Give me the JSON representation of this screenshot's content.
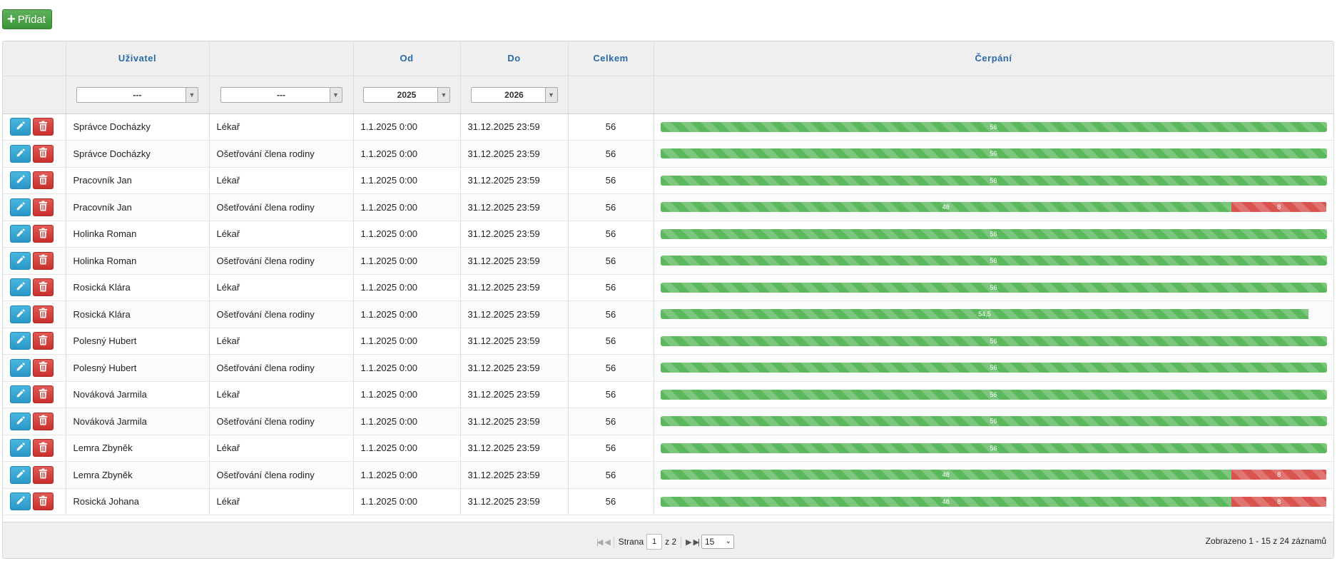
{
  "toolbar": {
    "add_label": "Přidat"
  },
  "columns": {
    "user": "Uživatel",
    "type": "",
    "from": "Od",
    "to": "Do",
    "total": "Celkem",
    "usage": "Čerpání"
  },
  "filters": {
    "user": "---",
    "type": "---",
    "from": "2025",
    "to": "2026"
  },
  "rows": [
    {
      "user": "Správce Docházky",
      "type": "Lékař",
      "from": "1.1.2025 0:00",
      "to": "31.12.2025 23:59",
      "total": "56",
      "used": "56",
      "over": ""
    },
    {
      "user": "Správce Docházky",
      "type": "Ošetřování člena rodiny",
      "from": "1.1.2025 0:00",
      "to": "31.12.2025 23:59",
      "total": "56",
      "used": "56",
      "over": ""
    },
    {
      "user": "Pracovník Jan",
      "type": "Lékař",
      "from": "1.1.2025 0:00",
      "to": "31.12.2025 23:59",
      "total": "56",
      "used": "56",
      "over": ""
    },
    {
      "user": "Pracovník Jan",
      "type": "Ošetřování člena rodiny",
      "from": "1.1.2025 0:00",
      "to": "31.12.2025 23:59",
      "total": "56",
      "used": "48",
      "over": "8"
    },
    {
      "user": "Holinka Roman",
      "type": "Lékař",
      "from": "1.1.2025 0:00",
      "to": "31.12.2025 23:59",
      "total": "56",
      "used": "56",
      "over": ""
    },
    {
      "user": "Holinka Roman",
      "type": "Ošetřování člena rodiny",
      "from": "1.1.2025 0:00",
      "to": "31.12.2025 23:59",
      "total": "56",
      "used": "56",
      "over": ""
    },
    {
      "user": "Rosická Klára",
      "type": "Lékař",
      "from": "1.1.2025 0:00",
      "to": "31.12.2025 23:59",
      "total": "56",
      "used": "56",
      "over": ""
    },
    {
      "user": "Rosická Klára",
      "type": "Ošetřování člena rodiny",
      "from": "1.1.2025 0:00",
      "to": "31.12.2025 23:59",
      "total": "56",
      "used": "54,5",
      "over": ""
    },
    {
      "user": "Polesný Hubert",
      "type": "Lékař",
      "from": "1.1.2025 0:00",
      "to": "31.12.2025 23:59",
      "total": "56",
      "used": "56",
      "over": ""
    },
    {
      "user": "Polesný Hubert",
      "type": "Ošetřování člena rodiny",
      "from": "1.1.2025 0:00",
      "to": "31.12.2025 23:59",
      "total": "56",
      "used": "56",
      "over": ""
    },
    {
      "user": "Nováková Jarmila",
      "type": "Lékař",
      "from": "1.1.2025 0:00",
      "to": "31.12.2025 23:59",
      "total": "56",
      "used": "56",
      "over": ""
    },
    {
      "user": "Nováková Jarmila",
      "type": "Ošetřování člena rodiny",
      "from": "1.1.2025 0:00",
      "to": "31.12.2025 23:59",
      "total": "56",
      "used": "56",
      "over": ""
    },
    {
      "user": "Lemra Zbyněk",
      "type": "Lékař",
      "from": "1.1.2025 0:00",
      "to": "31.12.2025 23:59",
      "total": "56",
      "used": "56",
      "over": ""
    },
    {
      "user": "Lemra Zbyněk",
      "type": "Ošetřování člena rodiny",
      "from": "1.1.2025 0:00",
      "to": "31.12.2025 23:59",
      "total": "56",
      "used": "48",
      "over": "8"
    },
    {
      "user": "Rosická Johana",
      "type": "Lékař",
      "from": "1.1.2025 0:00",
      "to": "31.12.2025 23:59",
      "total": "56",
      "used": "48",
      "over": "8"
    }
  ],
  "pager": {
    "page_label": "Strana",
    "page": "1",
    "of_label": "z 2",
    "page_size": "15",
    "summary": "Zobrazeno 1 - 15 z 24 záznamů"
  },
  "colors": {
    "green": "#5cb85c",
    "red": "#d9534f",
    "edit": "#2a97c7",
    "delete": "#c9302c",
    "header_text": "#2a6aa8"
  }
}
